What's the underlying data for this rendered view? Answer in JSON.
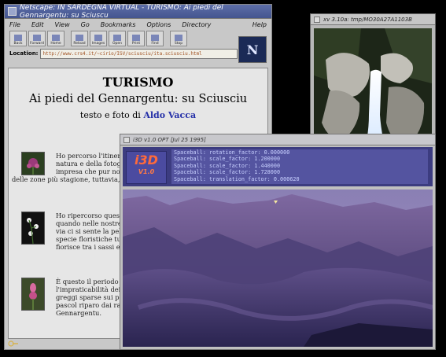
{
  "netscape": {
    "title": "Netscape: IN SARDEGNA VIRTUAL - TURISMO: Ai piedi del Gennargentu: su Sciuscu",
    "menu": [
      "File",
      "Edit",
      "View",
      "Go",
      "Bookmarks",
      "Options",
      "Directory"
    ],
    "help": "Help",
    "toolbar": [
      "Back",
      "Forward",
      "Home",
      "Reload",
      "Images",
      "Open",
      "Print",
      "Find",
      "Stop"
    ],
    "logo_letter": "N",
    "location_label": "Location:",
    "location_value": "http://www.crs4.it/~cirio/ISV/sciusciu/ita.sciusciu.html",
    "page": {
      "heading": "TURISMO",
      "subheading": "Ai piedi del Gennargentu: su Sciusciu",
      "byline_text": "testo e foto di",
      "byline_author": "Aldo Vacca",
      "para1": "Ho percorso l'itinerario di primavera, presso second della natura e della fotogr semplicemente amanti del questa impresa che pur non richiedendo g permette di entrare in una delle zone più stagione, tuttavia, ha da offrire le sue me",
      "para2": "Ho ripercorso questi sentieri p ogni volta ne ho tratto sensazi quando nelle nostre pianure il lassù l'aria profuma intensame via ci si sente la pelle impregn coperti dalle fioriture delle pe specie floristiche tutte naturisticamente o la saxifraga, che fiorisce tra i sassi e su",
      "para3": "È questo il periodo in cui rivivi sono rimasti chiusi e disabitat l'impraticabilità dei pascoli a costante della neve. Allora l'a greggi sparse sui pendii; è anch i branchi dei mufloni al pascol riparo dai raggi del sole, nelle ore più ca canalone del Gennargentu."
    }
  },
  "xv": {
    "title": "xv 3.10a: tmp/MO30A27A1103B"
  },
  "i3d": {
    "title": "i3D v1.0 OPT [Jul 25 1995]",
    "logo": "i3D",
    "logo_version": "V1.0",
    "params": [
      "Spaceball: rotation_factor: 0.000000",
      "Spaceball: scale_factor: 1.200000",
      "Spaceball: scale_factor: 1.440000",
      "Spaceball: scale_factor: 1.728000",
      "Spaceball: translation_factor: 0.000620"
    ]
  }
}
